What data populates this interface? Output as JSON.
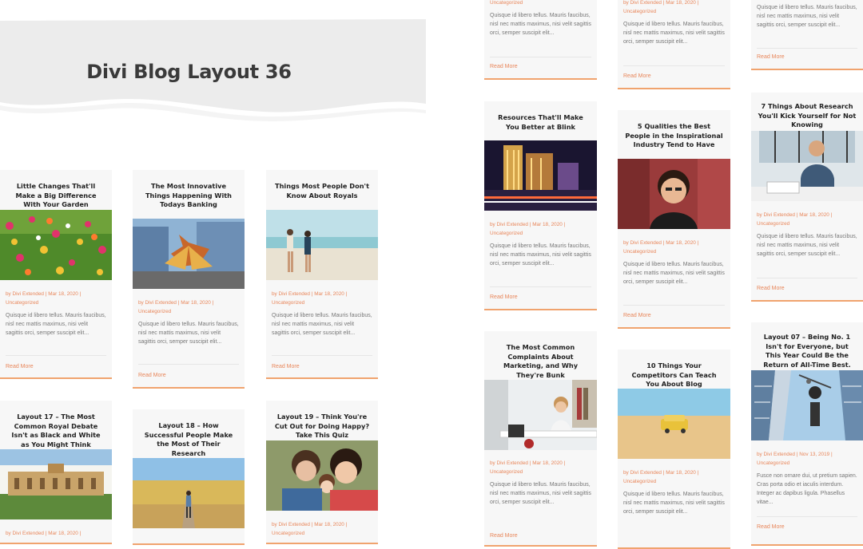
{
  "banner": {
    "title": "Divi Blog Layout 36"
  },
  "card_meta": {
    "author": "by Divi Extended",
    "date": "Mar 18, 2020",
    "category": "Uncategorized",
    "read_more": "Read More"
  },
  "excerpt": "Quisque id libero tellus. Mauris faucibus, nisl nec mattis maximus, nisi velit sagittis orci, semper suscipit elit...",
  "cards": [
    {
      "title": "Little Changes That'll Make a Big Difference With Your Garden"
    },
    {
      "title": "The Most Innovative Things Happening With Todays Banking"
    },
    {
      "title": "Things Most People Don't Know About Royals"
    },
    {
      "title": "Layout 17 – The Most Common Royal Debate Isn't as Black and White as You Might Think"
    },
    {
      "title": "Layout 18 – How Successful People Make the Most of Their Research"
    },
    {
      "title": "Layout 19 – Think You're Cut Out for Doing Happy? Take This Quiz"
    },
    {
      "title": "Resources That'll Make You Better at Blink"
    },
    {
      "title": "5 Qualities the Best People in the Inspirational Industry Tend to Have"
    },
    {
      "title": "7 Things About Research You'll Kick Yourself for Not Knowing"
    },
    {
      "title": "The Most Common Complaints About Marketing, and Why They're Bunk"
    },
    {
      "title": "10 Things Your Competitors Can Teach You About Blog"
    },
    {
      "title": "Layout 07 – Being No. 1 Isn't for Everyone, but This Year Could Be the Return of All-Time Best."
    }
  ],
  "special": {
    "date_nov": "Nov 13, 2019",
    "excerpt_alt": "Fusce non ornare dui, ut pretium sapien. Cras porta odio et iaculis interdum. Integer ac dapibus ligula. Phasellus vitae..."
  },
  "colors": {
    "accent": "#e8865a",
    "card_bg": "#f7f7f7",
    "banner_bg": "#ececec"
  }
}
